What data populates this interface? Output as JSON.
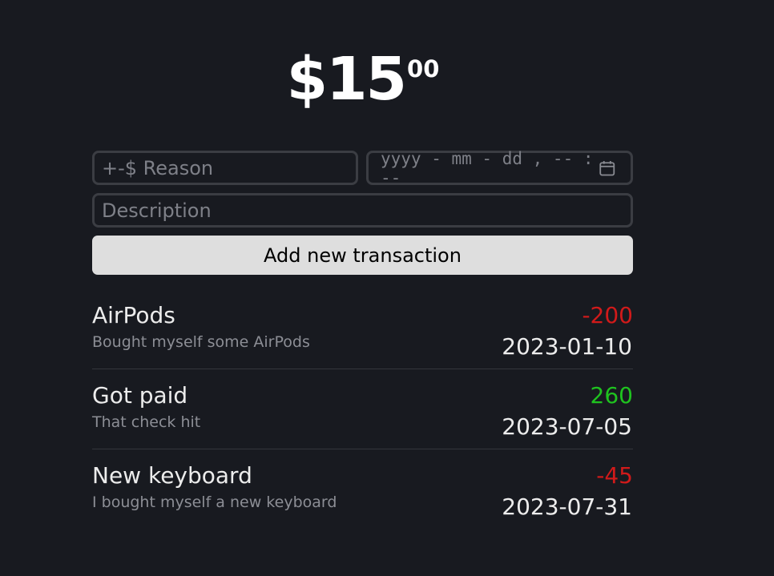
{
  "balance": {
    "dollars": "$15",
    "cents": "00"
  },
  "form": {
    "reason_placeholder": "+-$ Reason",
    "datetime_placeholder": "yyyy - mm - dd ,  -- : --",
    "description_placeholder": "Description",
    "add_button_label": "Add new transaction"
  },
  "transactions": [
    {
      "name": "AirPods",
      "description": "Bought myself some AirPods",
      "amount": "-200",
      "date": "2023-01-10"
    },
    {
      "name": "Got paid",
      "description": "That check hit",
      "amount": "260",
      "date": "2023-07-05"
    },
    {
      "name": "New keyboard",
      "description": "I bought myself a new keyboard",
      "amount": "-45",
      "date": "2023-07-31"
    }
  ],
  "colors": {
    "background": "#181a20",
    "negative": "#d11a1a",
    "positive": "#1fc31f",
    "button": "#dedede"
  }
}
